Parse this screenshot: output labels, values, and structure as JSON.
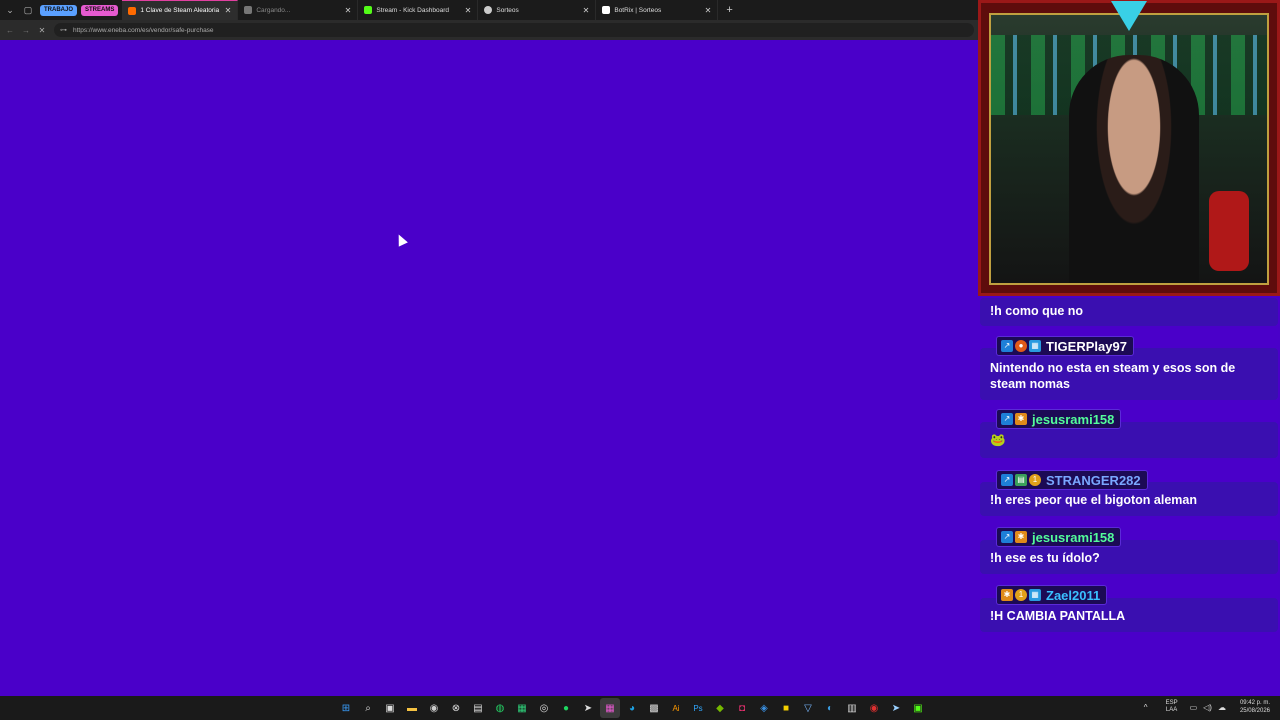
{
  "browser": {
    "group_labels": [
      {
        "label": "TRABAJO",
        "color": "#5aa0ff"
      },
      {
        "label": "STREAMS",
        "color": "#e65ad0"
      }
    ],
    "tabs": [
      {
        "title": "1 Clave de Steam Aleatoria - Edici",
        "favicon_color": "#ff6a00",
        "active": true
      },
      {
        "title": "Cargando...",
        "favicon_color": "#777777",
        "active": false
      },
      {
        "title": "Stream - Kick Dashboard",
        "favicon_color": "#53fc18",
        "active": false
      },
      {
        "title": "Sorteos",
        "favicon_color": "#cccccc",
        "active": false
      },
      {
        "title": "BotRix | Sorteos",
        "favicon_color": "#ffffff",
        "active": false
      }
    ],
    "url": "https://www.eneba.com/es/vendor/safe-purchase",
    "page_bg": "#4a00c9"
  },
  "chat": {
    "messages": [
      {
        "user": "",
        "text": "!h como que no"
      },
      {
        "user": "TIGERPlay97",
        "user_color": "#ffffff",
        "badges": [
          "mod-icon",
          "star-icon",
          "verified-icon"
        ],
        "text": "Nintendo no esta en steam y esos son de steam nomas"
      },
      {
        "user": "jesusrami158",
        "user_color": "#53fc9a",
        "badges": [
          "mod-icon",
          "gift-icon"
        ],
        "text": "🐸"
      },
      {
        "user": "STRANGER282",
        "user_color": "#7aa7ff",
        "badges": [
          "mod-icon",
          "chart-icon",
          "coin-icon"
        ],
        "text": "!h eres peor que el bigoton aleman"
      },
      {
        "user": "jesusrami158",
        "user_color": "#53fc9a",
        "badges": [
          "mod-icon",
          "gift-icon"
        ],
        "text": "!h ese es tu ídolo?"
      },
      {
        "user": "Zael2011",
        "user_color": "#3ac0ff",
        "badges": [
          "gift-icon",
          "coin-icon",
          "verified-icon"
        ],
        "text": "!H CAMBIA PANTALLA"
      }
    ]
  },
  "taskbar": {
    "icons": [
      "windows-icon",
      "search-icon",
      "taskview-icon",
      "folder-icon",
      "chrome-icon",
      "xbox-icon",
      "store-icon",
      "whatsapp-icon",
      "app-icon",
      "obs-icon",
      "spotify-icon",
      "steam-icon",
      "stream-icon",
      "edge-icon",
      "app2-icon",
      "illustrator-icon",
      "photoshop-icon",
      "nvidia-icon",
      "instagram-icon",
      "app3-icon",
      "app4-icon",
      "edge2-icon",
      "app5-icon",
      "app6-icon",
      "app7-icon",
      "steam2-icon",
      "app8-icon"
    ],
    "lang_top": "ESP",
    "lang_bottom": "LAA",
    "time": "09:42 p. m.",
    "date": "25/08/2026"
  }
}
